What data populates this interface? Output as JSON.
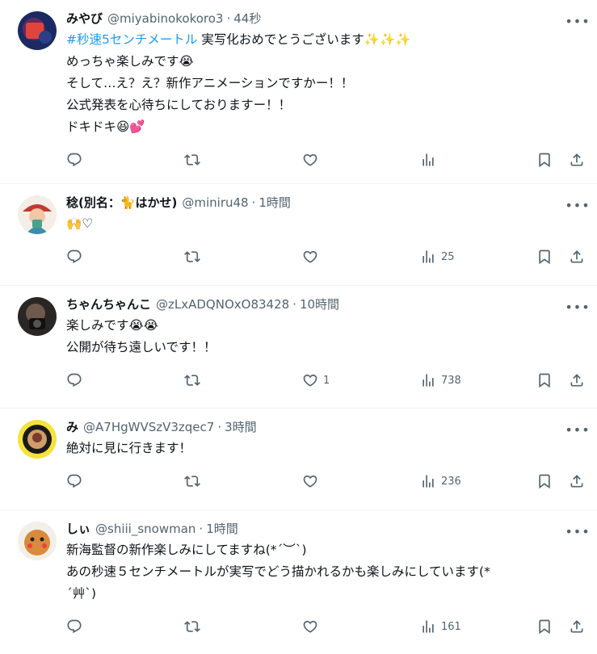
{
  "replies": [
    {
      "name": "みやび",
      "handle": "@miyabinokokoro3",
      "time": "44秒",
      "hashtag": "#秒速5センチメートル",
      "lines": [
        "実写化おめでとうございます✨✨✨",
        "めっちゃ楽しみです😭",
        "そして…え？え？新作アニメーションですかー！！",
        "公式発表を心待ちにしておりますー！！",
        "ドキドキ😆💕"
      ],
      "stats": {
        "replies": "",
        "reposts": "",
        "likes": "",
        "views": ""
      }
    },
    {
      "name": "稔(別名：🐈はかせ)",
      "handle": "@miniru48",
      "time": "1時間",
      "lines": [
        "🙌♡"
      ],
      "stats": {
        "replies": "",
        "reposts": "",
        "likes": "",
        "views": "25"
      }
    },
    {
      "name": "ちゃんちゃんこ",
      "handle": "@zLxADQNOxO83428",
      "time": "10時間",
      "lines": [
        "楽しみです😭😭",
        "公開が待ち遠しいです！！"
      ],
      "stats": {
        "replies": "",
        "reposts": "",
        "likes": "1",
        "views": "738"
      }
    },
    {
      "name": "み",
      "handle": "@A7HgWVSzV3zqec7",
      "time": "3時間",
      "lines": [
        "絶対に見に行きます！"
      ],
      "stats": {
        "replies": "",
        "reposts": "",
        "likes": "",
        "views": "236"
      }
    },
    {
      "name": "しぃ",
      "handle": "@shiii_snowman",
      "time": "1時間",
      "lines": [
        "新海監督の新作楽しみにしてますね(*´︶`)",
        "あの秒速５センチメートルが実写でどう描かれるかも楽しみにしています(*",
        "´艸`)"
      ],
      "stats": {
        "replies": "",
        "reposts": "",
        "likes": "",
        "views": "161"
      }
    }
  ],
  "ui": {
    "dot": "·",
    "more": "•••"
  },
  "icons": [
    "reply-icon",
    "repost-icon",
    "like-icon",
    "views-icon",
    "bookmark-icon",
    "share-icon",
    "more-icon"
  ],
  "colors": {
    "text": "#0f1419",
    "muted": "#536471",
    "link": "#1d9bf0",
    "border": "#eff3f4"
  }
}
